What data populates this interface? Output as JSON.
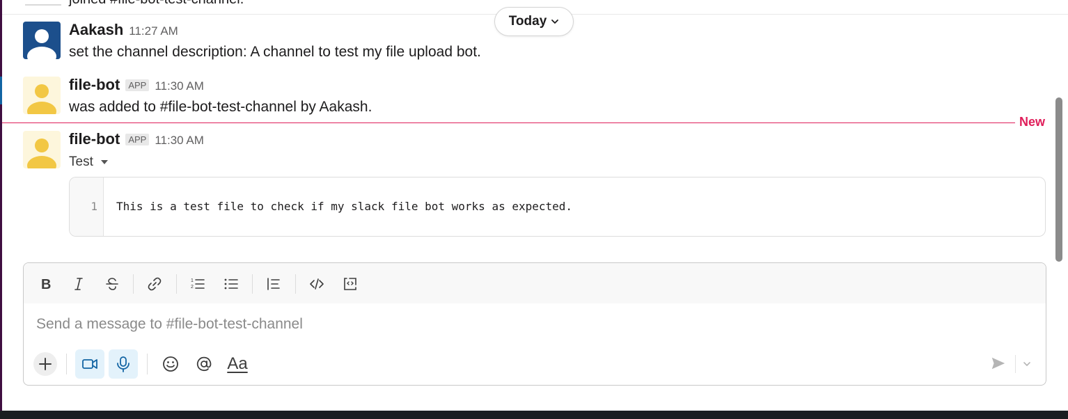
{
  "partial_top_text": "joined #file-bot-test-channel.",
  "date_pill": {
    "label": "Today",
    "icon": "chevron-down-icon"
  },
  "messages": [
    {
      "name": "Aakash",
      "time": "11:27 AM",
      "text": "set the channel description: A channel to test my file upload bot.",
      "avatar_color": "#1c4f8c"
    },
    {
      "name": "file-bot",
      "badge": "APP",
      "time": "11:30 AM",
      "text": "was added to #file-bot-test-channel by Aakash.",
      "avatar_color": "#fdf6dc"
    },
    {
      "name": "file-bot",
      "badge": "APP",
      "time": "11:30 AM",
      "avatar_color": "#fdf6dc",
      "file": {
        "title": "Test",
        "line_number": "1",
        "content": "This is a test file to check if my slack file bot works as expected."
      }
    }
  ],
  "new_divider": {
    "label": "New",
    "color": "#e01e5a"
  },
  "composer": {
    "placeholder": "Send a message to #file-bot-test-channel",
    "format_toolbar": [
      "bold-icon",
      "italic-icon",
      "strikethrough-icon",
      "link-icon",
      "ordered-list-icon",
      "bulleted-list-icon",
      "blockquote-icon",
      "code-icon",
      "code-block-icon"
    ],
    "actions": [
      "plus-icon",
      "video-icon",
      "microphone-icon",
      "emoji-icon",
      "mention-icon",
      "text-format-icon",
      "send-icon",
      "chevron-down-icon"
    ],
    "format_label": "Aa",
    "accent": "#1264a3"
  }
}
